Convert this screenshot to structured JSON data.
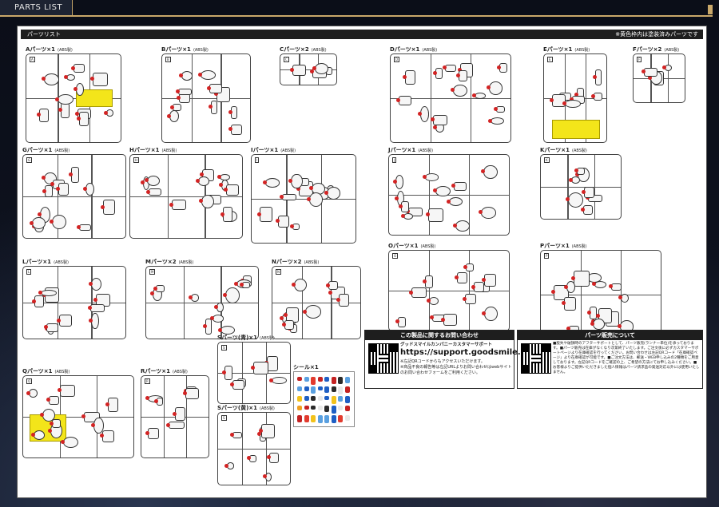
{
  "header": {
    "section_label": "PARTS LIST"
  },
  "sheet": {
    "title": "パーツリスト",
    "note": "※黄色枠内は塗装済みパーツです"
  },
  "runners": [
    {
      "id": "A",
      "label": "Aパーツ×1",
      "material": "(ABS製)",
      "has_painted": true
    },
    {
      "id": "B",
      "label": "Bパーツ×1",
      "material": "(ABS製)",
      "has_painted": false
    },
    {
      "id": "C",
      "label": "Cパーツ×2",
      "material": "(ABS製)",
      "has_painted": false
    },
    {
      "id": "D",
      "label": "Dパーツ×1",
      "material": "(ABS製)",
      "has_painted": false
    },
    {
      "id": "E",
      "label": "Eパーツ×1",
      "material": "(ABS製)",
      "has_painted": true
    },
    {
      "id": "F",
      "label": "Fパーツ×2",
      "material": "(ABS製)",
      "has_painted": false
    },
    {
      "id": "G",
      "label": "Gパーツ×1",
      "material": "(ABS製)",
      "has_painted": false
    },
    {
      "id": "H",
      "label": "Hパーツ×1",
      "material": "(ABS製)",
      "has_painted": false
    },
    {
      "id": "I",
      "label": "Iパーツ×1",
      "material": "(ABS製)",
      "has_painted": false
    },
    {
      "id": "J",
      "label": "Jパーツ×1",
      "material": "(ABS製)",
      "has_painted": false
    },
    {
      "id": "K",
      "label": "Kパーツ×1",
      "material": "(ABS製)",
      "has_painted": false
    },
    {
      "id": "L",
      "label": "Lパーツ×1",
      "material": "(ABS製)",
      "has_painted": false
    },
    {
      "id": "M",
      "label": "Mパーツ×2",
      "material": "(ABS製)",
      "has_painted": false
    },
    {
      "id": "N",
      "label": "Nパーツ×2",
      "material": "(ABS製)",
      "has_painted": false
    },
    {
      "id": "O",
      "label": "Oパーツ×1",
      "material": "(ABS製)",
      "has_painted": false
    },
    {
      "id": "P",
      "label": "Pパーツ×1",
      "material": "(ABS製)",
      "has_painted": false
    },
    {
      "id": "Q",
      "label": "Qパーツ×1",
      "material": "(ABS製)",
      "has_painted": true
    },
    {
      "id": "R",
      "label": "Rパーツ×1",
      "material": "(ABS製)",
      "has_painted": false
    },
    {
      "id": "S_blue",
      "label": "Sパーツ(青)×1",
      "material": "(ABS製)",
      "has_painted": false
    },
    {
      "id": "S_yellow",
      "label": "Sパーツ(黄)×1",
      "material": "(ABS製)",
      "has_painted": false
    },
    {
      "id": "seal",
      "label": "シール×1",
      "material": "",
      "has_painted": false
    }
  ],
  "contact": {
    "heading": "この製品に関するお問い合わせ",
    "company": "グッドスマイルカンパニーカスタマーサポート",
    "url": "https://support.goodsmile.com/",
    "note1": "※左記QRコードからもアクセスいただけます。",
    "note2": "※商品不良の報告等は左記URLよりお問い合わせはwebサイトのお問い合わせフォームをご利用ください。"
  },
  "parts_sale": {
    "heading": "パーツ販売について",
    "body": "■股失や破損時のアフターサポートとして、パーツ販売(ランナー単位)を承っております。■パーツ販売は在庫がなくなり次第終了いたします。ご注文後に必ずカスタマーサポートページより在庫確認を行ってください。お問い合わせは左記QRコード「在庫確認ページ」より在庫確認が可能です。■ご注文方法は、郵送・WEB申し込みの2種類をご用意しております。左記QRコードをご確認の上、ご希望の方法にてお申し込みください。■お客様よりご提供いただきました個人情報はパーツ請求品の発送対応以外には使用いたしません。"
  }
}
